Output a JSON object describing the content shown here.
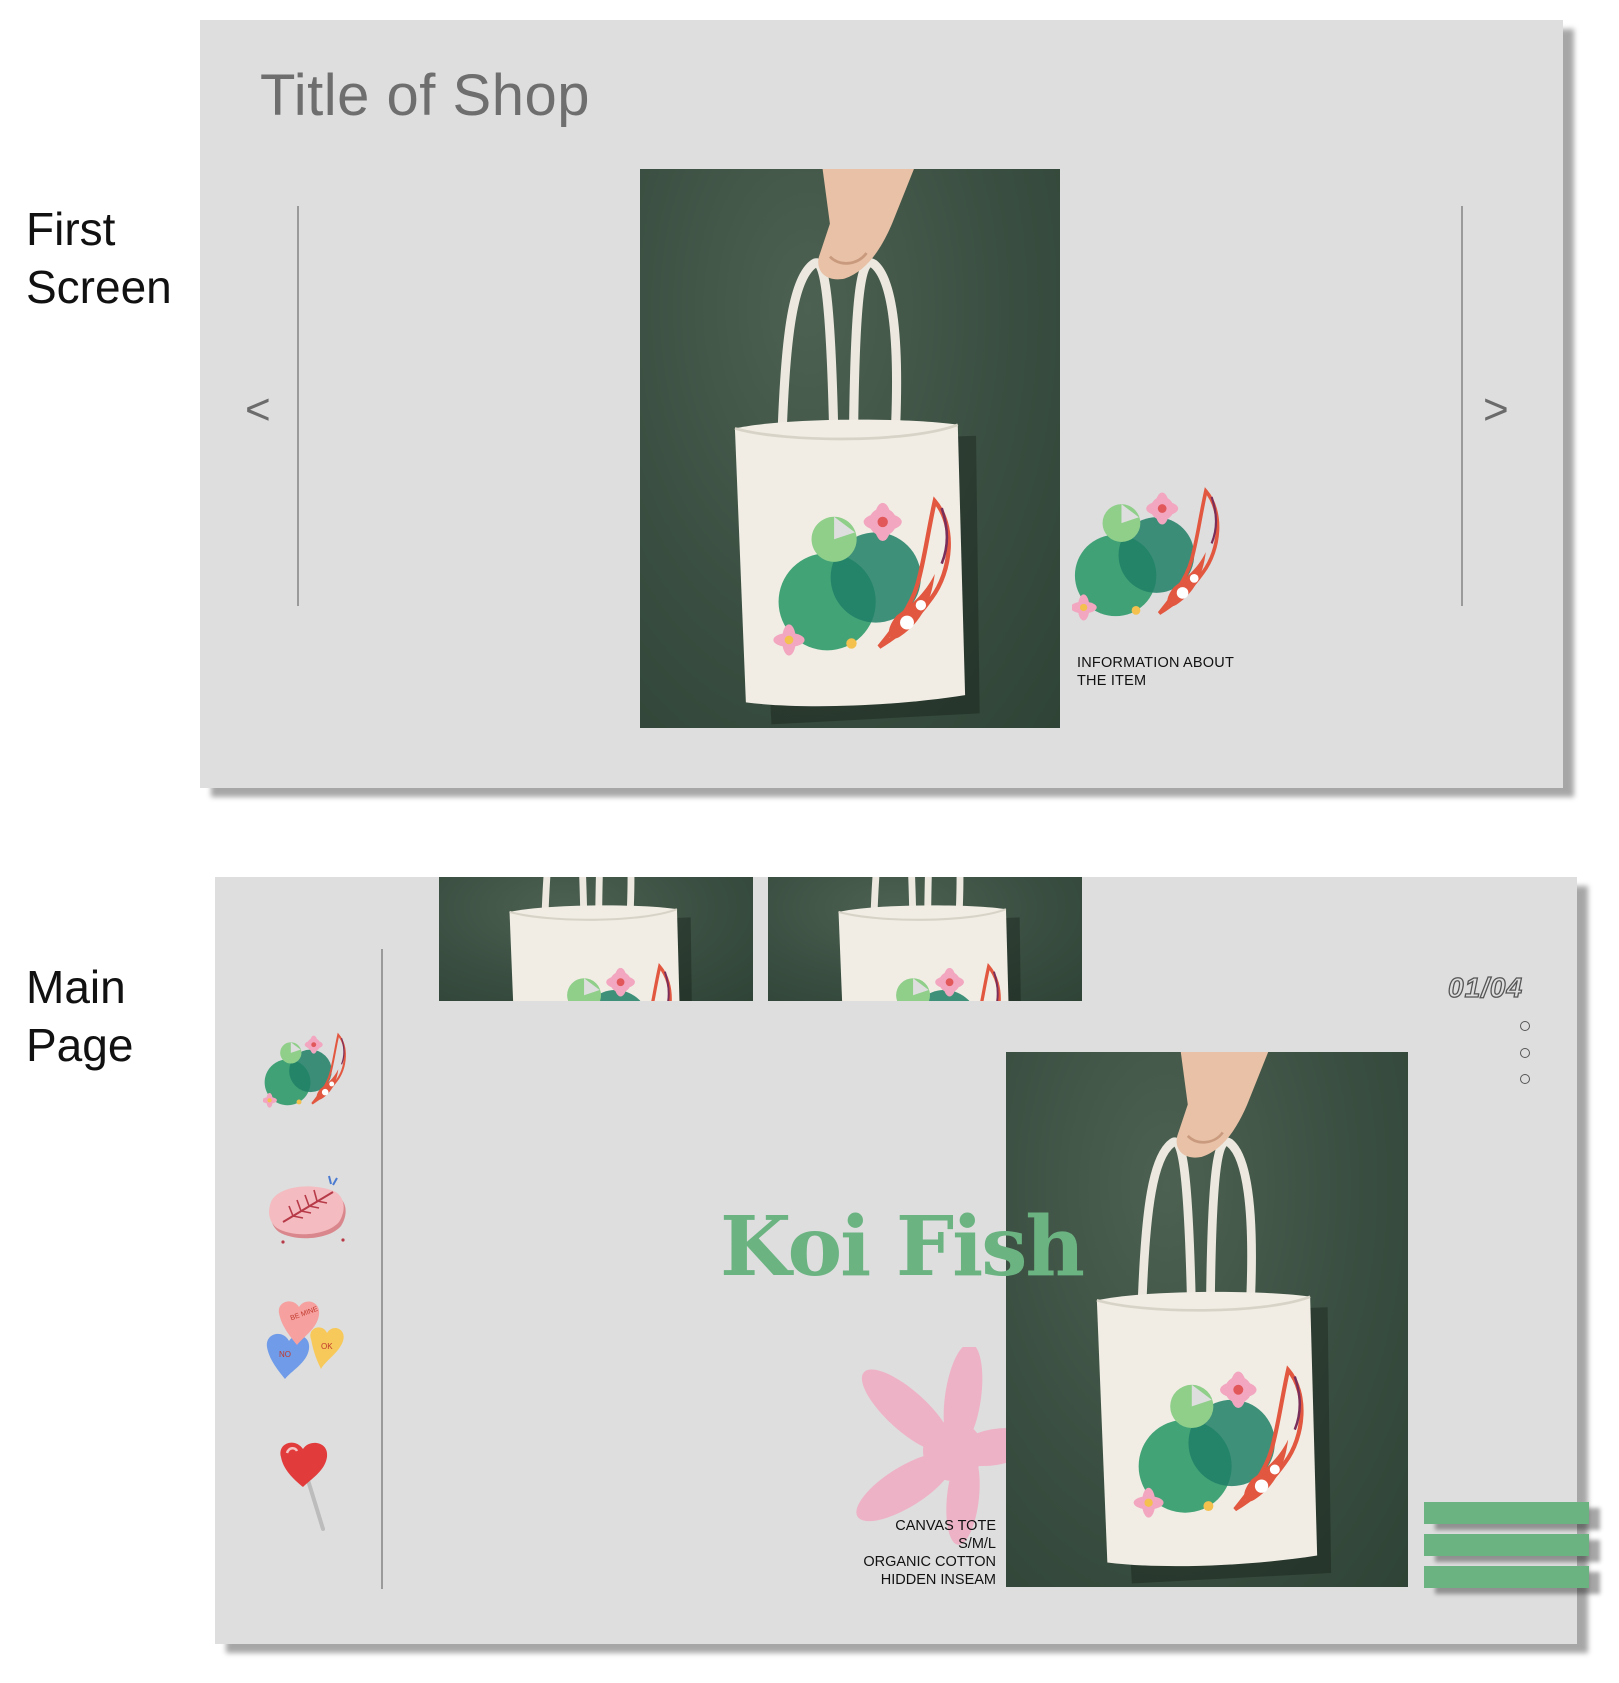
{
  "labels": {
    "first_screen": [
      "First",
      "Screen"
    ],
    "main_page": [
      "Main",
      "Page"
    ]
  },
  "first_screen": {
    "shop_title": "Title of Shop",
    "prev_arrow": "<",
    "next_arrow": ">",
    "item_info": [
      "INFORMATION ABOUT",
      "THE ITEM"
    ]
  },
  "main_page": {
    "counter": "01/04",
    "product_name": "Koi Fish",
    "specs": [
      "CANVAS TOTE",
      "S/M/L",
      "ORGANIC COTTON",
      "HIDDEN INSEAM"
    ],
    "sidebar_items": [
      "koi-fish-sticker-icon",
      "pink-leaf-sticker-icon",
      "candy-hearts-sticker-icon",
      "heart-lollipop-sticker-icon"
    ],
    "candy_heart_texts": [
      "BE MINE",
      "NO",
      "OK"
    ],
    "pagination_dots": 3,
    "menu_lines": 3
  },
  "colors": {
    "background": "#dedede",
    "panel_green": "#3a4f41",
    "accent_green": "#6bb482",
    "flower_pink": "#eeb2c7"
  }
}
